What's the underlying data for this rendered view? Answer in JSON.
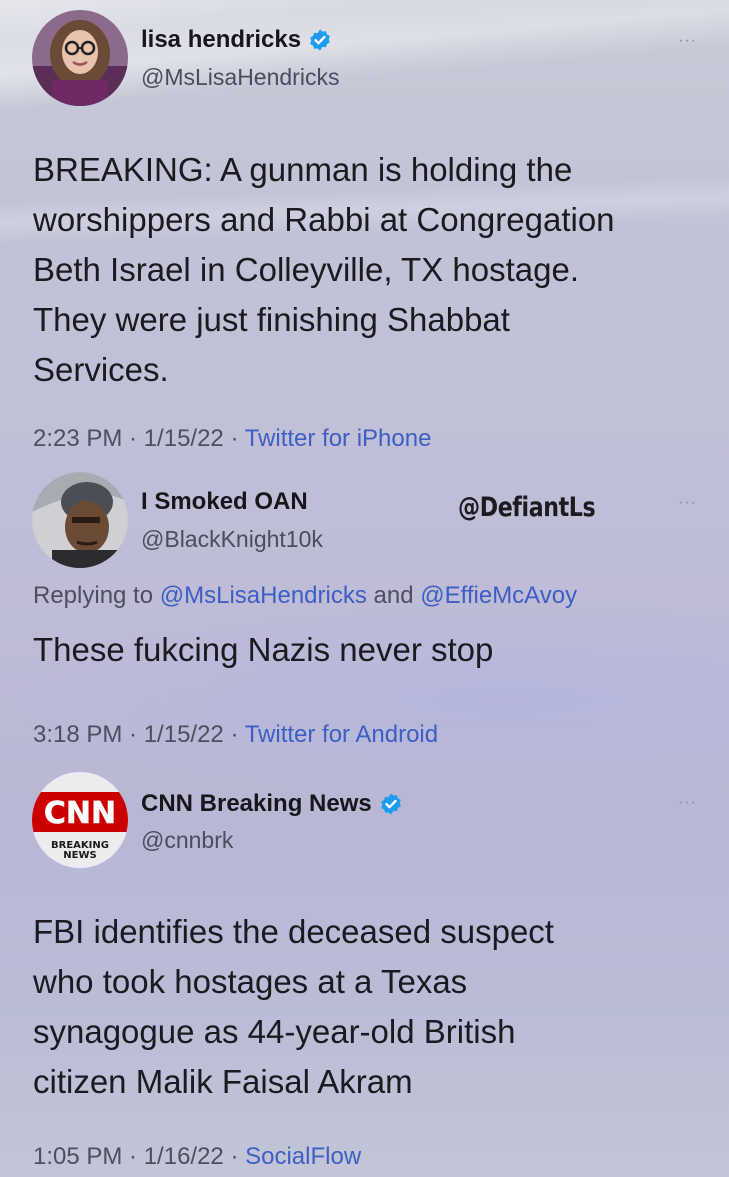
{
  "tweets": [
    {
      "display_name": "lisa hendricks",
      "verified": true,
      "handle": "@MsLisaHendricks",
      "text_lines": [
        "BREAKING: A gunman is holding the",
        "worshippers and Rabbi at Congregation",
        "Beth Israel in Colleyville, TX hostage.",
        "They were just finishing Shabbat",
        "Services."
      ],
      "time": "2:23 PM · 1/15/22 · ",
      "source": "Twitter for iPhone",
      "more": "···"
    },
    {
      "display_name": "I Smoked OAN",
      "verified": false,
      "handle": "@BlackKnight10k",
      "replying_prefix": "Replying to ",
      "replying_user_1": "@MsLisaHendricks",
      "replying_and": " and ",
      "replying_user_2": "@EffieMcAvoy",
      "text_lines": [
        "These fukcing Nazis never stop"
      ],
      "time": "3:18 PM · 1/15/22 · ",
      "source": "Twitter for Android",
      "more": "···"
    },
    {
      "display_name": "CNN Breaking News",
      "verified": true,
      "handle": "@cnnbrk",
      "logo_text": "CNN",
      "logo_sub_1": "BREAKING",
      "logo_sub_2": "NEWS",
      "text_lines": [
        "FBI identifies the deceased suspect",
        "who took hostages at a Texas",
        "synagogue as 44-year-old British",
        "citizen Malik Faisal Akram"
      ],
      "time": "1:05 PM · 1/16/22 · ",
      "source": "SocialFlow",
      "more": "···"
    }
  ],
  "watermark": "@DefiantLs",
  "colors": {
    "link": "#3e5ec4",
    "verified": "#1d9bf0",
    "cnn_red": "#cc0000"
  }
}
